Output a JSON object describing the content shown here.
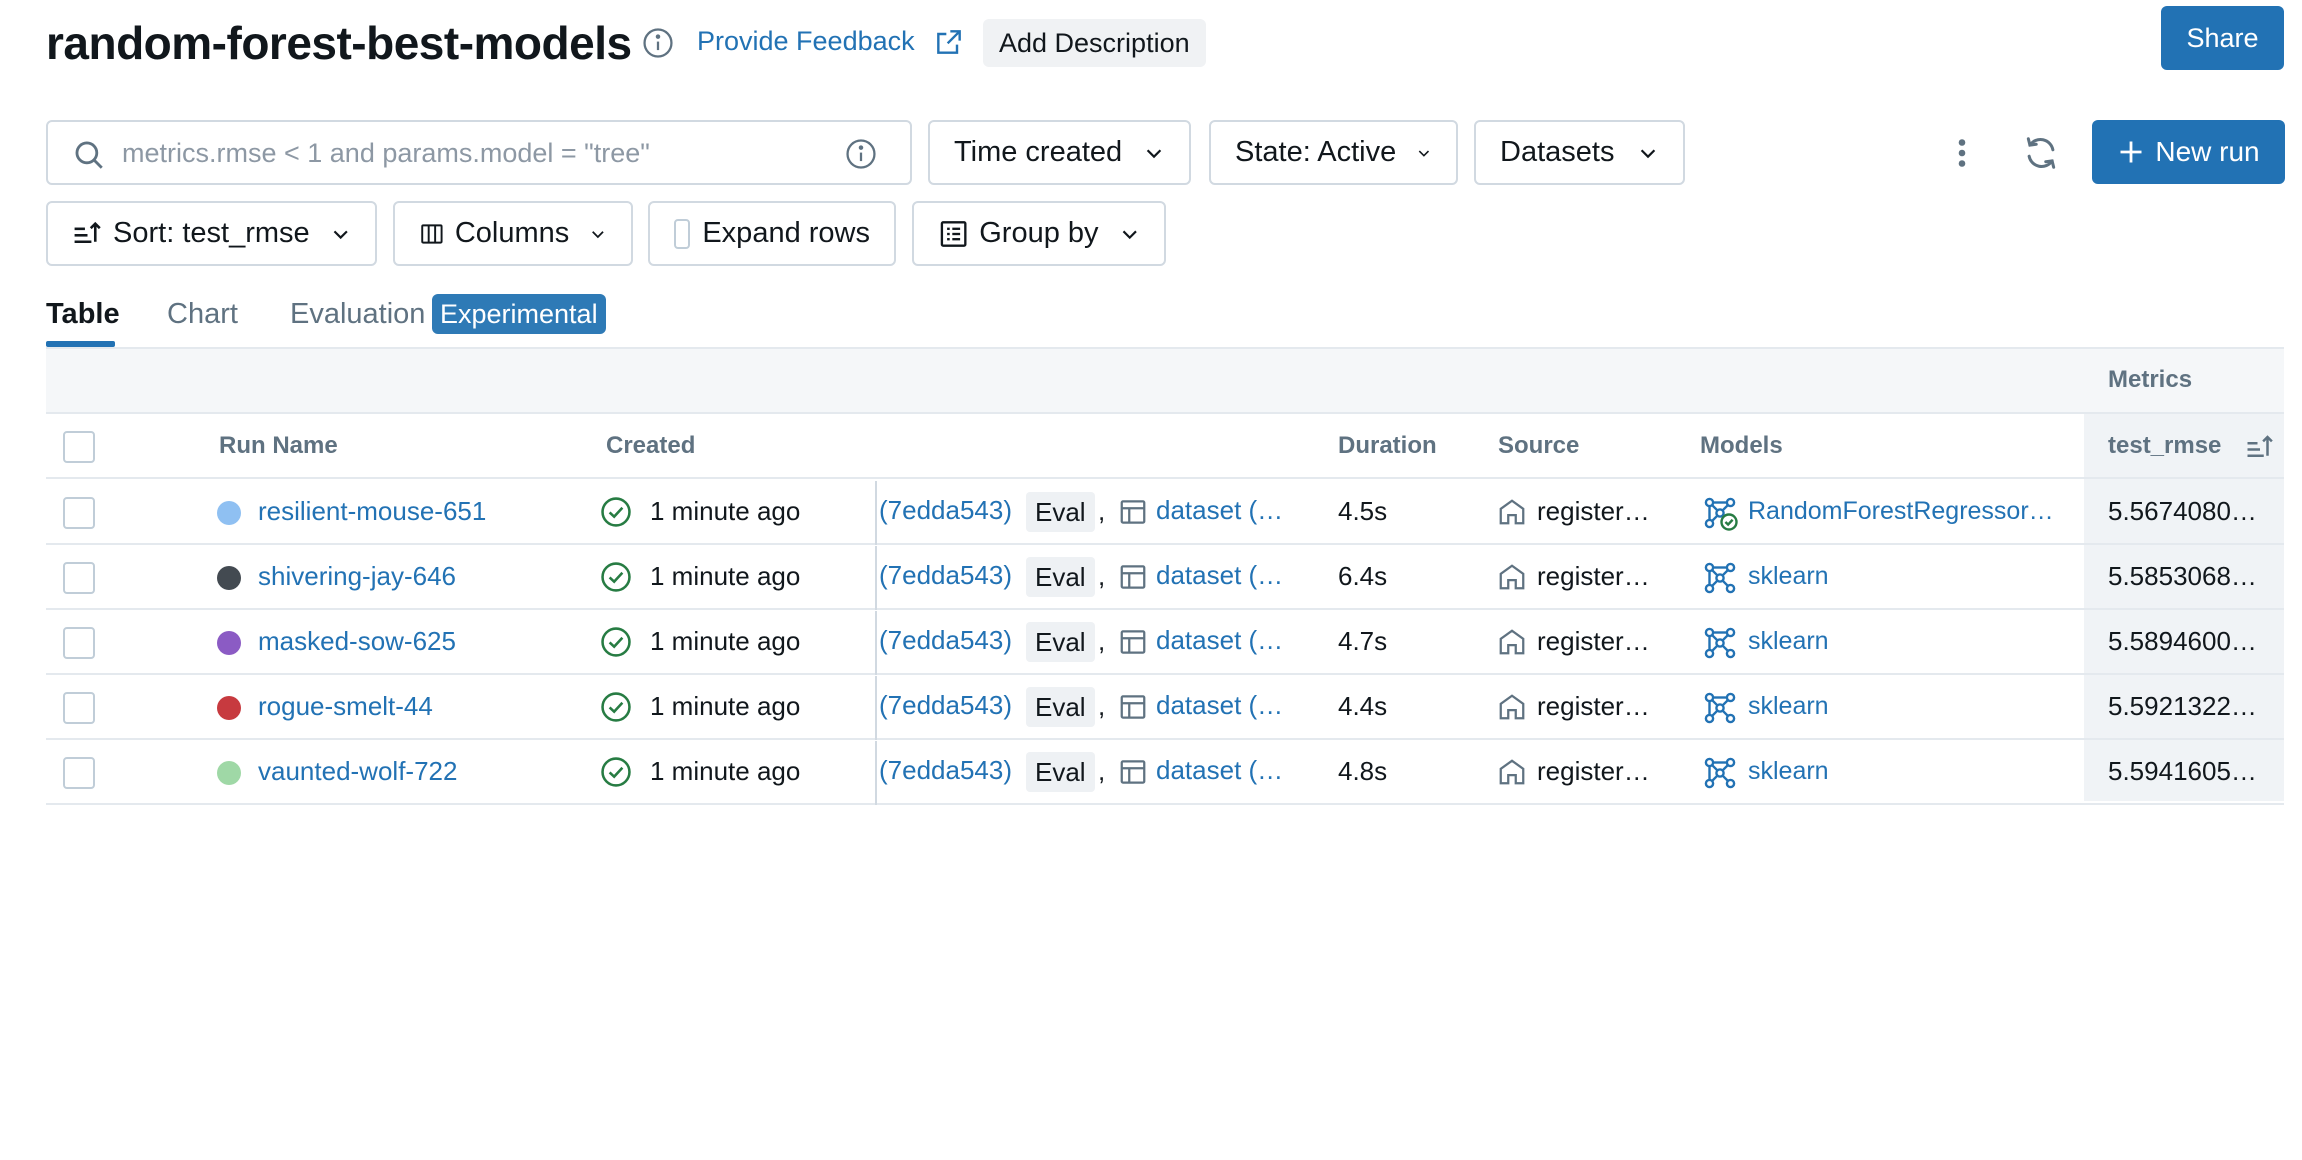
{
  "header": {
    "title": "random-forest-best-models",
    "feedback_label": "Provide Feedback",
    "add_description_label": "Add Description",
    "share_label": "Share"
  },
  "toolbar": {
    "search_placeholder": "metrics.rmse < 1 and params.model = \"tree\"",
    "time_created_label": "Time created",
    "state_label": "State: Active",
    "datasets_label": "Datasets",
    "new_run_label": "New run",
    "sort_label": "Sort: test_rmse",
    "columns_label": "Columns",
    "expand_rows_label": "Expand rows",
    "group_by_label": "Group by"
  },
  "tabs": [
    {
      "label": "Table",
      "active": true
    },
    {
      "label": "Chart",
      "active": false
    },
    {
      "label": "Evaluation",
      "active": false
    }
  ],
  "experimental_badge": "Experimental",
  "table": {
    "group_header": "Metrics",
    "columns": {
      "run_name": "Run Name",
      "created": "Created",
      "duration": "Duration",
      "source": "Source",
      "models": "Models",
      "metric": "test_rmse"
    },
    "rows": [
      {
        "color": "#8fc0f2",
        "run_name": "resilient-mouse-651",
        "created": "1 minute ago",
        "hash": "(7edda543)",
        "eval": "Eval",
        "comma": ",",
        "dataset": "dataset (…",
        "duration": "4.5s",
        "source": "register…",
        "model": "RandomForestRegressor…",
        "model_icon": "registered-model-icon",
        "test_rmse": "5.5674080…"
      },
      {
        "color": "#434a51",
        "run_name": "shivering-jay-646",
        "created": "1 minute ago",
        "hash": "(7edda543)",
        "eval": "Eval",
        "comma": ",",
        "dataset": "dataset (…",
        "duration": "6.4s",
        "source": "register…",
        "model": "sklearn",
        "model_icon": "model-icon",
        "test_rmse": "5.5853068…"
      },
      {
        "color": "#8b5bc4",
        "run_name": "masked-sow-625",
        "created": "1 minute ago",
        "hash": "(7edda543)",
        "eval": "Eval",
        "comma": ",",
        "dataset": "dataset (…",
        "duration": "4.7s",
        "source": "register…",
        "model": "sklearn",
        "model_icon": "model-icon",
        "test_rmse": "5.5894600…"
      },
      {
        "color": "#c73a3f",
        "run_name": "rogue-smelt-44",
        "created": "1 minute ago",
        "hash": "(7edda543)",
        "eval": "Eval",
        "comma": ",",
        "dataset": "dataset (…",
        "duration": "4.4s",
        "source": "register…",
        "model": "sklearn",
        "model_icon": "model-icon",
        "test_rmse": "5.5921322…"
      },
      {
        "color": "#9fd8a6",
        "run_name": "vaunted-wolf-722",
        "created": "1 minute ago",
        "hash": "(7edda543)",
        "eval": "Eval",
        "comma": ",",
        "dataset": "dataset (…",
        "duration": "4.8s",
        "source": "register…",
        "model": "sklearn",
        "model_icon": "model-icon",
        "test_rmse": "5.5941605…"
      }
    ]
  },
  "colors": {
    "accent": "#2272b4",
    "success": "#277c43",
    "border": "#d1d9e1",
    "muted_text": "#5f7281"
  },
  "icons": {
    "search": "search-icon",
    "info": "info-icon",
    "external_link": "external-link-icon",
    "chevron": "chevron-down-icon",
    "kebab": "kebab-menu-icon",
    "refresh": "refresh-icon",
    "plus": "plus-icon",
    "sort": "sort-ascending-icon",
    "columns": "columns-icon",
    "group_by": "list-icon",
    "status": "check-circle-icon",
    "dataset": "table-icon",
    "source": "home-icon"
  }
}
